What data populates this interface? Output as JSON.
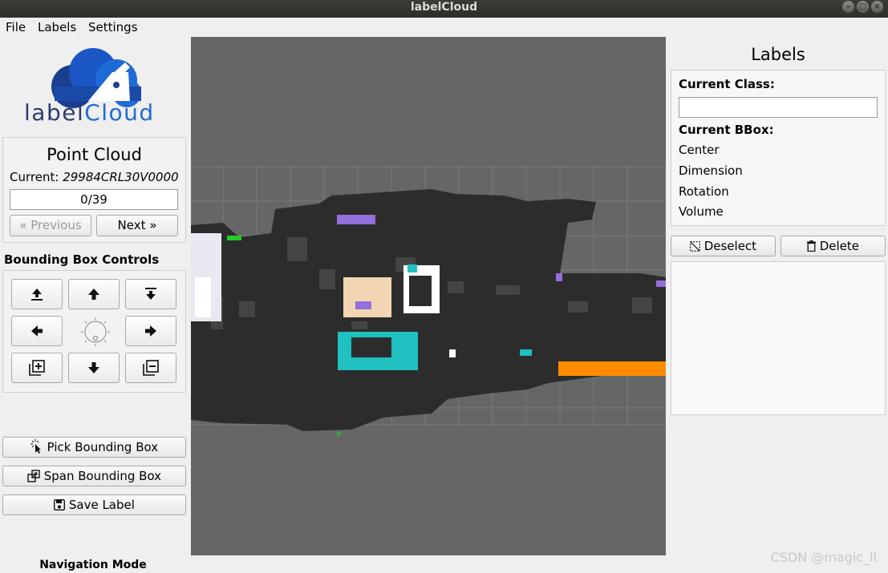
{
  "window": {
    "title": "labelCloud"
  },
  "menu": {
    "file": "File",
    "labels": "Labels",
    "settings": "Settings"
  },
  "logo": {
    "text_pre": "label",
    "text_post": "Cloud"
  },
  "point_cloud": {
    "heading": "Point Cloud",
    "current_label": "Current:",
    "current_file": "29984CRL30V0000",
    "progress": "0/39",
    "previous": "« Previous",
    "next": "Next »"
  },
  "bbox_controls": {
    "heading": "Bounding Box Controls"
  },
  "actions": {
    "pick": "Pick Bounding Box",
    "span": "Span Bounding Box",
    "save": "Save Label"
  },
  "mode": "Navigation Mode",
  "labels_panel": {
    "title": "Labels",
    "current_class": "Current Class:",
    "class_value": "",
    "current_bbox": "Current BBox:",
    "center": "Center",
    "dimension": "Dimension",
    "rotation": "Rotation",
    "volume": "Volume",
    "deselect": "Deselect",
    "delete": "Delete"
  },
  "watermark": "CSDN @magic_ll",
  "colors": {
    "viewport_bg": "#666666",
    "cloud": "#2a2a2a",
    "accent_blue": "#1f6bd6"
  }
}
